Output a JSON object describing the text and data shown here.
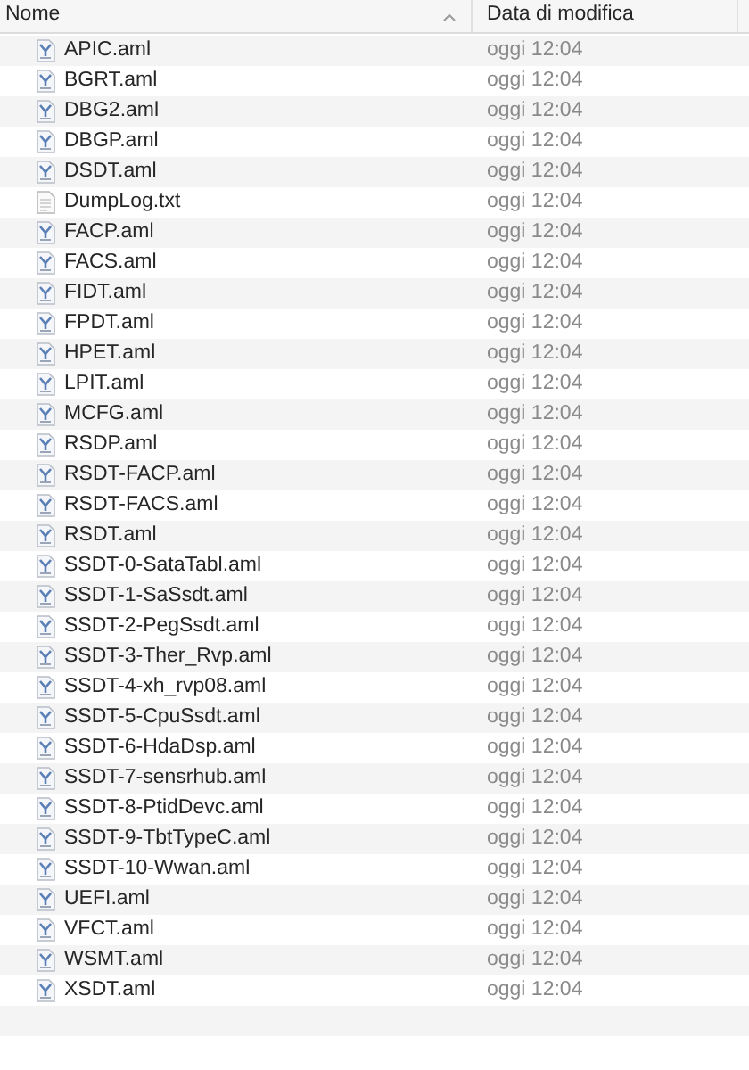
{
  "columns": [
    "Nome",
    "Data di modifica"
  ],
  "files": [
    {
      "name": "APIC.aml",
      "kind": "aml",
      "modified": "oggi 12:04"
    },
    {
      "name": "BGRT.aml",
      "kind": "aml",
      "modified": "oggi 12:04"
    },
    {
      "name": "DBG2.aml",
      "kind": "aml",
      "modified": "oggi 12:04"
    },
    {
      "name": "DBGP.aml",
      "kind": "aml",
      "modified": "oggi 12:04"
    },
    {
      "name": "DSDT.aml",
      "kind": "aml",
      "modified": "oggi 12:04"
    },
    {
      "name": "DumpLog.txt",
      "kind": "text",
      "modified": "oggi 12:04"
    },
    {
      "name": "FACP.aml",
      "kind": "aml",
      "modified": "oggi 12:04"
    },
    {
      "name": "FACS.aml",
      "kind": "aml",
      "modified": "oggi 12:04"
    },
    {
      "name": "FIDT.aml",
      "kind": "aml",
      "modified": "oggi 12:04"
    },
    {
      "name": "FPDT.aml",
      "kind": "aml",
      "modified": "oggi 12:04"
    },
    {
      "name": "HPET.aml",
      "kind": "aml",
      "modified": "oggi 12:04"
    },
    {
      "name": "LPIT.aml",
      "kind": "aml",
      "modified": "oggi 12:04"
    },
    {
      "name": "MCFG.aml",
      "kind": "aml",
      "modified": "oggi 12:04"
    },
    {
      "name": "RSDP.aml",
      "kind": "aml",
      "modified": "oggi 12:04"
    },
    {
      "name": "RSDT-FACP.aml",
      "kind": "aml",
      "modified": "oggi 12:04"
    },
    {
      "name": "RSDT-FACS.aml",
      "kind": "aml",
      "modified": "oggi 12:04"
    },
    {
      "name": "RSDT.aml",
      "kind": "aml",
      "modified": "oggi 12:04"
    },
    {
      "name": "SSDT-0-SataTabl.aml",
      "kind": "aml",
      "modified": "oggi 12:04"
    },
    {
      "name": "SSDT-1-SaSsdt.aml",
      "kind": "aml",
      "modified": "oggi 12:04"
    },
    {
      "name": "SSDT-2-PegSsdt.aml",
      "kind": "aml",
      "modified": "oggi 12:04"
    },
    {
      "name": "SSDT-3-Ther_Rvp.aml",
      "kind": "aml",
      "modified": "oggi 12:04"
    },
    {
      "name": "SSDT-4-xh_rvp08.aml",
      "kind": "aml",
      "modified": "oggi 12:04"
    },
    {
      "name": "SSDT-5-CpuSsdt.aml",
      "kind": "aml",
      "modified": "oggi 12:04"
    },
    {
      "name": "SSDT-6-HdaDsp.aml",
      "kind": "aml",
      "modified": "oggi 12:04"
    },
    {
      "name": "SSDT-7-sensrhub.aml",
      "kind": "aml",
      "modified": "oggi 12:04"
    },
    {
      "name": "SSDT-8-PtidDevc.aml",
      "kind": "aml",
      "modified": "oggi 12:04"
    },
    {
      "name": "SSDT-9-TbtTypeC.aml",
      "kind": "aml",
      "modified": "oggi 12:04"
    },
    {
      "name": "SSDT-10-Wwan.aml",
      "kind": "aml",
      "modified": "oggi 12:04"
    },
    {
      "name": "UEFI.aml",
      "kind": "aml",
      "modified": "oggi 12:04"
    },
    {
      "name": "VFCT.aml",
      "kind": "aml",
      "modified": "oggi 12:04"
    },
    {
      "name": "WSMT.aml",
      "kind": "aml",
      "modified": "oggi 12:04"
    },
    {
      "name": "XSDT.aml",
      "kind": "aml",
      "modified": "oggi 12:04"
    }
  ]
}
